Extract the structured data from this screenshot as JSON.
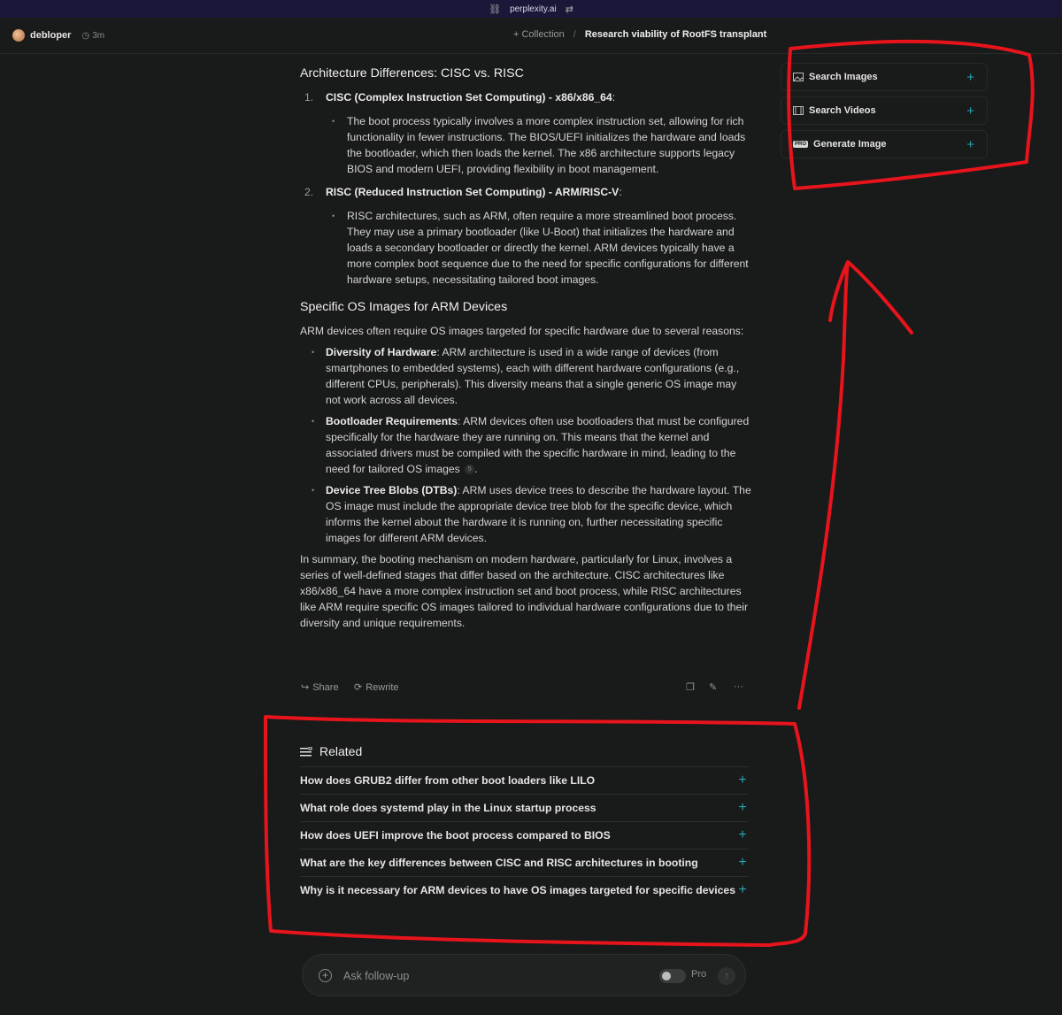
{
  "browser": {
    "url": "perplexity.ai"
  },
  "header": {
    "user": "debloper",
    "time": "3m",
    "collection_label": "Collection",
    "separator": "/",
    "thread_title": "Research viability of RootFS transplant"
  },
  "article": {
    "section1_title": "Architecture Differences: CISC vs. RISC",
    "items": [
      {
        "num": "1.",
        "heading": "CISC (Complex Instruction Set Computing) - x86/x86_64",
        "suffix": ":",
        "detail": "The boot process typically involves a more complex instruction set, allowing for rich functionality in fewer instructions. The BIOS/UEFI initializes the hardware and loads the bootloader, which then loads the kernel. The x86 architecture supports legacy BIOS and modern UEFI, providing flexibility in boot management."
      },
      {
        "num": "2.",
        "heading": "RISC (Reduced Instruction Set Computing) - ARM/RISC-V",
        "suffix": ":",
        "detail": "RISC architectures, such as ARM, often require a more streamlined boot process. They may use a primary bootloader (like U-Boot) that initializes the hardware and loads a secondary bootloader or directly the kernel. ARM devices typically have a more complex boot sequence due to the need for specific configurations for different hardware setups, necessitating tailored boot images."
      }
    ],
    "section2_title": "Specific OS Images for ARM Devices",
    "intro": "ARM devices often require OS images targeted for specific hardware due to several reasons:",
    "bullets": [
      {
        "term": "Diversity of Hardware",
        "text": ": ARM architecture is used in a wide range of devices (from smartphones to embedded systems), each with different hardware configurations (e.g., different CPUs, peripherals). This diversity means that a single generic OS image may not work across all devices."
      },
      {
        "term": "Bootloader Requirements",
        "text": ": ARM devices often use bootloaders that must be configured specifically for the hardware they are running on. This means that the kernel and associated drivers must be compiled with the specific hardware in mind, leading to the need for tailored OS images",
        "cite": "5",
        "after": "."
      },
      {
        "term": "Device Tree Blobs (DTBs)",
        "text": ": ARM uses device trees to describe the hardware layout. The OS image must include the appropriate device tree blob for the specific device, which informs the kernel about the hardware it is running on, further necessitating specific images for different ARM devices."
      }
    ],
    "summary": "In summary, the booting mechanism on modern hardware, particularly for Linux, involves a series of well-defined stages that differ based on the architecture. CISC architectures like x86/x86_64 have a more complex instruction set and boot process, while RISC architectures like ARM require specific OS images tailored to individual hardware configurations due to their diversity and unique requirements."
  },
  "actions": {
    "share": "Share",
    "rewrite": "Rewrite"
  },
  "related": {
    "title": "Related",
    "items": [
      "How does GRUB2 differ from other boot loaders like LILO",
      "What role does systemd play in the Linux startup process",
      "How does UEFI improve the boot process compared to BIOS",
      "What are the key differences between CISC and RISC architectures in booting",
      "Why is it necessary for ARM devices to have OS images targeted for specific devices"
    ]
  },
  "sidebar": {
    "buttons": [
      "Search Images",
      "Search Videos",
      "Generate Image"
    ],
    "pro_badge": "PRO"
  },
  "followup": {
    "placeholder": "Ask follow-up",
    "pro_label": "Pro"
  },
  "colors": {
    "accent": "#25a6b5",
    "annotation": "#e8141c",
    "background": "#191a1a"
  }
}
